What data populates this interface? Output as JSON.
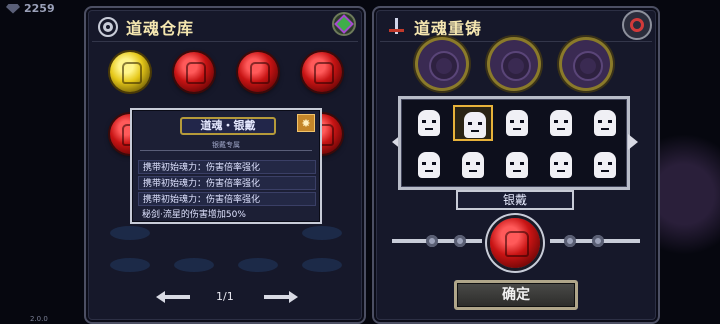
{
  "top_stat": {
    "value": "2259"
  },
  "version": "2.0.0",
  "warehouse": {
    "title": "道魂仓库",
    "pager": {
      "label": "1/1"
    }
  },
  "tooltip": {
    "title": "道魂・银戴",
    "subtitle": "银戴专属",
    "lines": [
      "携带初始魂力：伤害倍率强化",
      "携带初始魂力：伤害倍率强化",
      "携带初始魂力：伤害倍率强化",
      "秘剑·流星的伤害增加50%"
    ]
  },
  "recast": {
    "title": "道魂重铸",
    "selected_name": "银戴",
    "confirm_label": "确定"
  },
  "colors": {
    "accent_gold": "#e7b23a",
    "orb_red": "#c81414",
    "orb_gold": "#e6c81a",
    "panel_bg": "#16182a"
  }
}
